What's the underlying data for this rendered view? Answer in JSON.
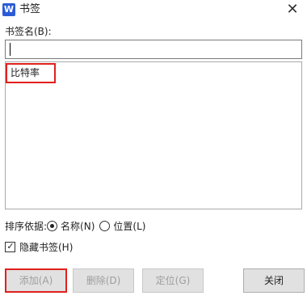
{
  "window": {
    "title": "书签",
    "app_icon_letter": "W",
    "close_glyph": "✕"
  },
  "bookmark_name": {
    "label": "书签名(B):",
    "value": ""
  },
  "bookmarks": [
    {
      "name": "比特率"
    }
  ],
  "sort": {
    "label": "排序依据:",
    "options": [
      {
        "label": "名称(N)",
        "selected": true
      },
      {
        "label": "位置(L)",
        "selected": false
      }
    ]
  },
  "hidden_bookmarks": {
    "label": "隐藏书签(H)",
    "checked": true
  },
  "buttons": {
    "add": "添加(A)",
    "delete": "删除(D)",
    "locate": "定位(G)",
    "close": "关闭"
  },
  "colors": {
    "highlight": "#e0201c",
    "app_icon": "#2b5cd6"
  }
}
